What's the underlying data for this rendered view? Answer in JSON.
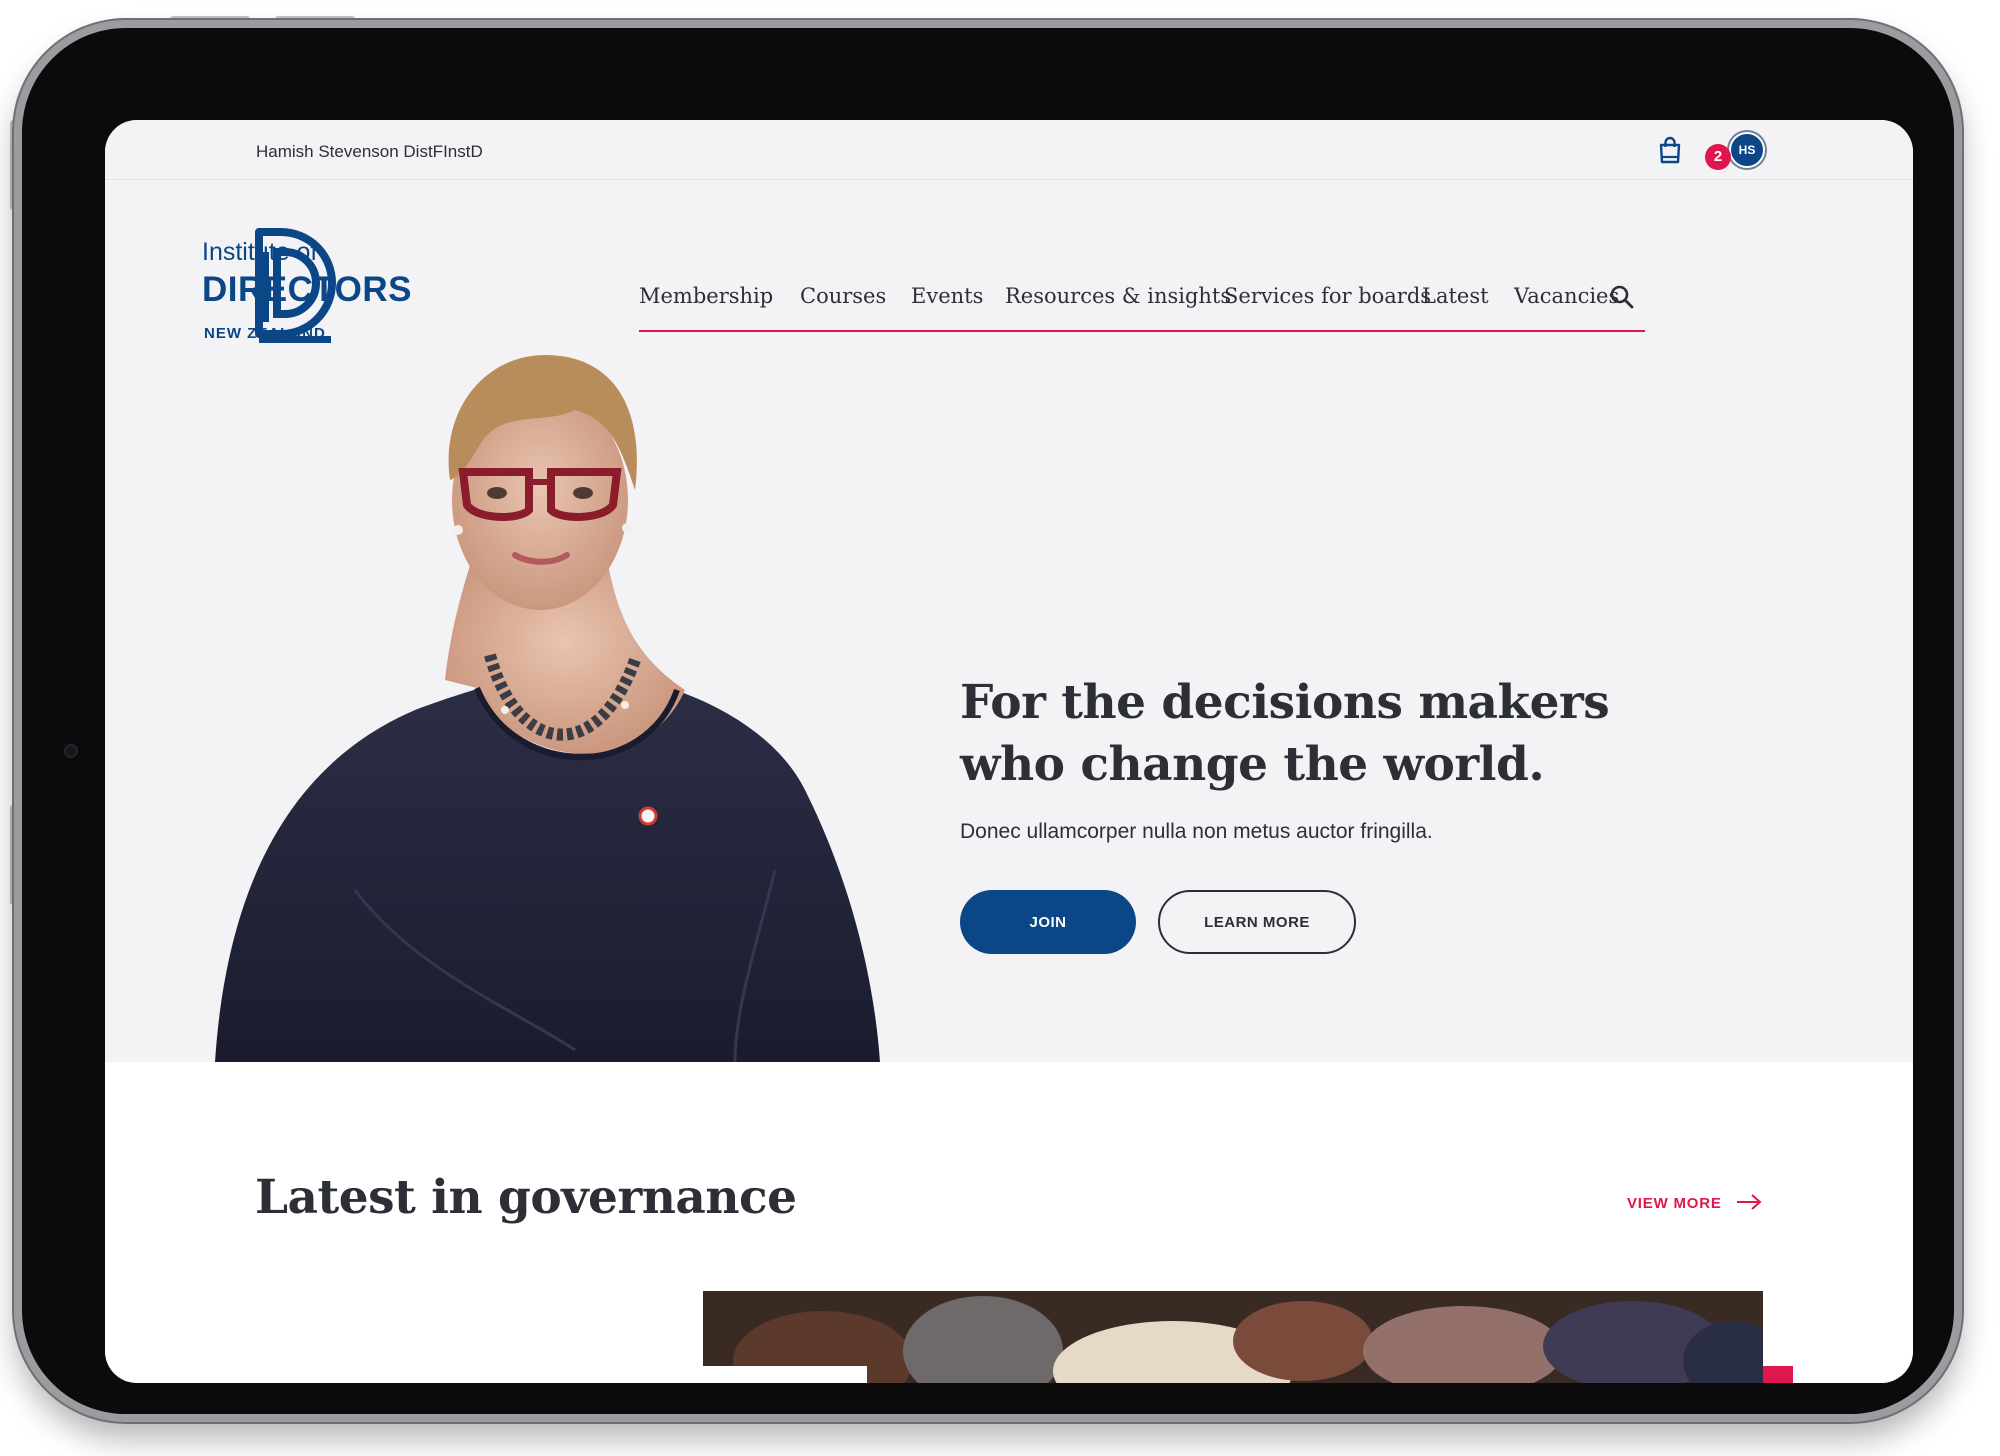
{
  "user": {
    "name": "Hamish Stevenson DistFInstD",
    "initials": "HS",
    "notification_count": "2"
  },
  "logo": {
    "line1": "Institute of",
    "line2": "DIRECTORS",
    "line3": "NEW ZEALAND"
  },
  "nav": {
    "items": [
      "Membership",
      "Courses",
      "Events",
      "Resources & insights",
      "Services for boards",
      "Latest",
      "Vacancies"
    ]
  },
  "hero": {
    "title": "For the decisions makers who change the world.",
    "subtitle": "Donec ullamcorper nulla non metus auctor fringilla.",
    "join_label": "JOIN",
    "learn_more_label": "LEARN MORE"
  },
  "latest": {
    "title": "Latest in governance",
    "view_more_label": "VIEW MORE"
  },
  "colors": {
    "brand_blue": "#0b4786",
    "accent_pink": "#e0174d",
    "text_dark": "#2d2f36",
    "hero_bg": "#f3f3f6"
  },
  "icons": [
    "cart-icon",
    "search-icon",
    "arrow-right-icon",
    "avatar"
  ]
}
